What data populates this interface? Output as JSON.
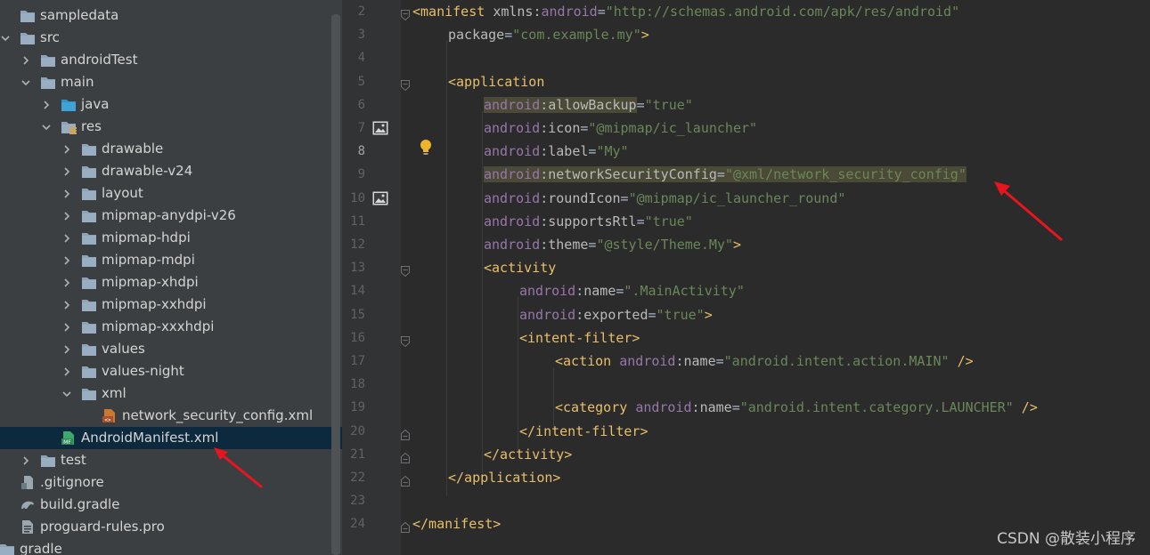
{
  "project_tree": {
    "items": [
      {
        "label": "sampledata",
        "depth": 0,
        "icon": "folder-icon",
        "expand": "none"
      },
      {
        "label": "src",
        "depth": 0,
        "icon": "folder-icon",
        "expand": "expanded"
      },
      {
        "label": "androidTest",
        "depth": 1,
        "icon": "folder-icon",
        "expand": "collapsed"
      },
      {
        "label": "main",
        "depth": 1,
        "icon": "folder-icon",
        "expand": "expanded"
      },
      {
        "label": "java",
        "depth": 2,
        "icon": "source-folder-icon",
        "expand": "collapsed"
      },
      {
        "label": "res",
        "depth": 2,
        "icon": "resource-folder-icon",
        "expand": "expanded"
      },
      {
        "label": "drawable",
        "depth": 3,
        "icon": "folder-icon",
        "expand": "collapsed"
      },
      {
        "label": "drawable-v24",
        "depth": 3,
        "icon": "folder-icon",
        "expand": "collapsed"
      },
      {
        "label": "layout",
        "depth": 3,
        "icon": "folder-icon",
        "expand": "collapsed"
      },
      {
        "label": "mipmap-anydpi-v26",
        "depth": 3,
        "icon": "folder-icon",
        "expand": "collapsed"
      },
      {
        "label": "mipmap-hdpi",
        "depth": 3,
        "icon": "folder-icon",
        "expand": "collapsed"
      },
      {
        "label": "mipmap-mdpi",
        "depth": 3,
        "icon": "folder-icon",
        "expand": "collapsed"
      },
      {
        "label": "mipmap-xhdpi",
        "depth": 3,
        "icon": "folder-icon",
        "expand": "collapsed"
      },
      {
        "label": "mipmap-xxhdpi",
        "depth": 3,
        "icon": "folder-icon",
        "expand": "collapsed"
      },
      {
        "label": "mipmap-xxxhdpi",
        "depth": 3,
        "icon": "folder-icon",
        "expand": "collapsed"
      },
      {
        "label": "values",
        "depth": 3,
        "icon": "folder-icon",
        "expand": "collapsed"
      },
      {
        "label": "values-night",
        "depth": 3,
        "icon": "folder-icon",
        "expand": "collapsed"
      },
      {
        "label": "xml",
        "depth": 3,
        "icon": "folder-icon",
        "expand": "expanded"
      },
      {
        "label": "network_security_config.xml",
        "depth": 4,
        "icon": "xml-file-icon",
        "expand": "none"
      },
      {
        "label": "AndroidManifest.xml",
        "depth": 2,
        "icon": "manifest-file-icon",
        "expand": "none",
        "selected": true
      },
      {
        "label": "test",
        "depth": 1,
        "icon": "folder-icon",
        "expand": "collapsed"
      },
      {
        "label": ".gitignore",
        "depth": 0,
        "icon": "gitignore-file-icon",
        "expand": "none"
      },
      {
        "label": "build.gradle",
        "depth": 0,
        "icon": "gradle-file-icon",
        "expand": "none"
      },
      {
        "label": "proguard-rules.pro",
        "depth": 0,
        "icon": "text-file-icon",
        "expand": "none"
      },
      {
        "label": "gradle",
        "depth": -1,
        "icon": "folder-icon",
        "expand": "none"
      }
    ]
  },
  "editor": {
    "current_line": "8",
    "lines": [
      {
        "num": "2",
        "indent": 0,
        "fold": "open",
        "tokens": [
          {
            "t": "<manifest ",
            "c": "tag"
          },
          {
            "t": "xmlns",
            "c": "attr"
          },
          {
            "t": ":",
            "c": "plain"
          },
          {
            "t": "android",
            "c": "ns"
          },
          {
            "t": "=",
            "c": "plain"
          },
          {
            "t": "\"http://schemas.android.com/apk/res/android\"",
            "c": "val"
          }
        ]
      },
      {
        "num": "3",
        "indent": 1,
        "tokens": [
          {
            "t": "package",
            "c": "attr"
          },
          {
            "t": "=",
            "c": "plain"
          },
          {
            "t": "\"com.example.my\"",
            "c": "val"
          },
          {
            "t": ">",
            "c": "tag"
          }
        ]
      },
      {
        "num": "4",
        "indent": 0,
        "tokens": []
      },
      {
        "num": "5",
        "indent": 1,
        "fold": "open",
        "tokens": [
          {
            "t": "<application",
            "c": "tag"
          }
        ]
      },
      {
        "num": "6",
        "indent": 2,
        "tokens": [
          {
            "t": "android",
            "c": "ns",
            "hl": true
          },
          {
            "t": ":",
            "c": "plain",
            "hl": true
          },
          {
            "t": "allowBackup",
            "c": "attr",
            "hl": true
          },
          {
            "t": "=",
            "c": "plain"
          },
          {
            "t": "\"true\"",
            "c": "val"
          }
        ]
      },
      {
        "num": "7",
        "indent": 2,
        "gutter_icon": "image-icon",
        "tokens": [
          {
            "t": "android",
            "c": "ns"
          },
          {
            "t": ":",
            "c": "plain"
          },
          {
            "t": "icon",
            "c": "attr"
          },
          {
            "t": "=",
            "c": "plain"
          },
          {
            "t": "\"@mipmap/ic_launcher\"",
            "c": "val"
          }
        ]
      },
      {
        "num": "8",
        "indent": 2,
        "tokens": [
          {
            "t": "android",
            "c": "ns"
          },
          {
            "t": ":",
            "c": "plain"
          },
          {
            "t": "label",
            "c": "attr"
          },
          {
            "t": "=",
            "c": "plain"
          },
          {
            "t": "\"My\"",
            "c": "val"
          }
        ]
      },
      {
        "num": "9",
        "indent": 2,
        "tokens": [
          {
            "t": "android",
            "c": "ns",
            "hl": true
          },
          {
            "t": ":",
            "c": "plain",
            "hl": true
          },
          {
            "t": "networkSecurityConfig",
            "c": "attr",
            "hl": true
          },
          {
            "t": "=",
            "c": "plain",
            "hl": true
          },
          {
            "t": "\"@xml/network_security_config\"",
            "c": "val",
            "hl": true
          }
        ]
      },
      {
        "num": "10",
        "indent": 2,
        "gutter_icon": "image-icon",
        "tokens": [
          {
            "t": "android",
            "c": "ns"
          },
          {
            "t": ":",
            "c": "plain"
          },
          {
            "t": "roundIcon",
            "c": "attr"
          },
          {
            "t": "=",
            "c": "plain"
          },
          {
            "t": "\"@mipmap/ic_launcher_round\"",
            "c": "val"
          }
        ]
      },
      {
        "num": "11",
        "indent": 2,
        "tokens": [
          {
            "t": "android",
            "c": "ns"
          },
          {
            "t": ":",
            "c": "plain"
          },
          {
            "t": "supportsRtl",
            "c": "attr"
          },
          {
            "t": "=",
            "c": "plain"
          },
          {
            "t": "\"true\"",
            "c": "val"
          }
        ]
      },
      {
        "num": "12",
        "indent": 2,
        "tokens": [
          {
            "t": "android",
            "c": "ns"
          },
          {
            "t": ":",
            "c": "plain"
          },
          {
            "t": "theme",
            "c": "attr"
          },
          {
            "t": "=",
            "c": "plain"
          },
          {
            "t": "\"@style/Theme.My\"",
            "c": "val"
          },
          {
            "t": ">",
            "c": "tag"
          }
        ]
      },
      {
        "num": "13",
        "indent": 2,
        "fold": "open",
        "tokens": [
          {
            "t": "<activity",
            "c": "tag"
          }
        ]
      },
      {
        "num": "14",
        "indent": 3,
        "tokens": [
          {
            "t": "android",
            "c": "ns"
          },
          {
            "t": ":",
            "c": "plain"
          },
          {
            "t": "name",
            "c": "attr"
          },
          {
            "t": "=",
            "c": "plain"
          },
          {
            "t": "\".MainActivity\"",
            "c": "val"
          }
        ]
      },
      {
        "num": "15",
        "indent": 3,
        "tokens": [
          {
            "t": "android",
            "c": "ns"
          },
          {
            "t": ":",
            "c": "plain"
          },
          {
            "t": "exported",
            "c": "attr"
          },
          {
            "t": "=",
            "c": "plain"
          },
          {
            "t": "\"true\"",
            "c": "val"
          },
          {
            "t": ">",
            "c": "tag"
          }
        ]
      },
      {
        "num": "16",
        "indent": 3,
        "fold": "open",
        "tokens": [
          {
            "t": "<intent-filter>",
            "c": "tag"
          }
        ]
      },
      {
        "num": "17",
        "indent": 4,
        "tokens": [
          {
            "t": "<action ",
            "c": "tag"
          },
          {
            "t": "android",
            "c": "ns"
          },
          {
            "t": ":",
            "c": "plain"
          },
          {
            "t": "name",
            "c": "attr"
          },
          {
            "t": "=",
            "c": "plain"
          },
          {
            "t": "\"android.intent.action.MAIN\" ",
            "c": "val"
          },
          {
            "t": "/>",
            "c": "tag"
          }
        ]
      },
      {
        "num": "18",
        "indent": 0,
        "tokens": []
      },
      {
        "num": "19",
        "indent": 4,
        "tokens": [
          {
            "t": "<category ",
            "c": "tag"
          },
          {
            "t": "android",
            "c": "ns"
          },
          {
            "t": ":",
            "c": "plain"
          },
          {
            "t": "name",
            "c": "attr"
          },
          {
            "t": "=",
            "c": "plain"
          },
          {
            "t": "\"android.intent.category.LAUNCHER\" ",
            "c": "val"
          },
          {
            "t": "/>",
            "c": "tag"
          }
        ]
      },
      {
        "num": "20",
        "indent": 3,
        "fold": "close",
        "tokens": [
          {
            "t": "</intent-filter>",
            "c": "tag"
          }
        ]
      },
      {
        "num": "21",
        "indent": 2,
        "fold": "close",
        "tokens": [
          {
            "t": "</activity>",
            "c": "tag"
          }
        ]
      },
      {
        "num": "22",
        "indent": 1,
        "fold": "close",
        "tokens": [
          {
            "t": "</application>",
            "c": "tag"
          }
        ]
      },
      {
        "num": "23",
        "indent": 0,
        "tokens": []
      },
      {
        "num": "24",
        "indent": 0,
        "fold": "close",
        "tokens": [
          {
            "t": "</manifest>",
            "c": "tag"
          }
        ]
      }
    ]
  },
  "colors": {
    "tag": "#e8bf6a",
    "namespace": "#9876aa",
    "attribute": "#bababa",
    "string": "#6a8759",
    "plain": "#a9b7c6",
    "annotation_arrow": "#e8151f",
    "selection": "#0d293e"
  },
  "watermark": "CSDN @散装小程序"
}
